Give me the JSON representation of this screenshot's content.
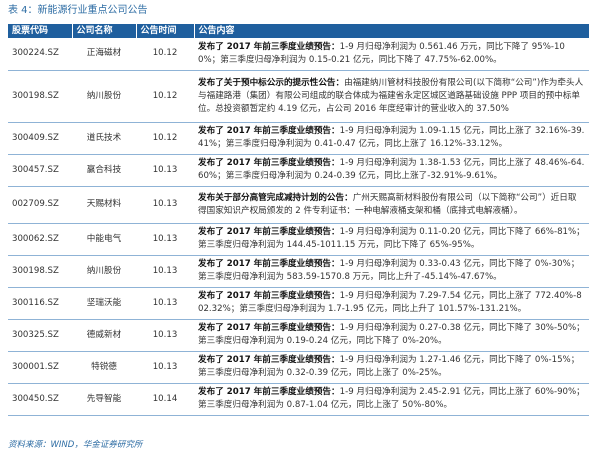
{
  "caption": "表 4：新能源行业重点公司公告",
  "headers": {
    "code": "股票代码",
    "name": "公司名称",
    "time": "公告时间",
    "content": "公告内容"
  },
  "rows": [
    {
      "code": "300224.SZ",
      "name": "正海磁材",
      "date": "10.12",
      "title": "发布了 2017 年前三季度业绩预告：",
      "body": "1-9 月归母净利润为 0.561.46 万元，同比下降了 95%-100%；第三季度归母净利润为 0.15-0.21 亿元，同比下降了 47.75%-62.00%。"
    },
    {
      "code": "300198.SZ",
      "name": "纳川股份",
      "date": "10.12",
      "title": "发布了关于预中标公示的提示性公告：",
      "body": "由福建纳川管材科技股份有限公司(以下简称“公司”)作为牵头人与福建路港（集团）有限公司组成的联合体成为福建省永定区城区道路基础设施 PPP 项目的预中标单位。总投资额暂定约 4.19 亿元，占公司 2016 年度经审计的营业收入的 37.50%"
    },
    {
      "code": "300409.SZ",
      "name": "道氏技术",
      "date": "10.12",
      "title": "发布了 2017 年前三季度业绩预告：",
      "body": "1-9 月归母净利润为 1.09-1.15 亿元，同比上涨了 32.16%-39.41%；第三季度归母净利润为 0.41-0.47 亿元，同比上涨了 16.12%-33.12%。"
    },
    {
      "code": "300457.SZ",
      "name": "赢合科技",
      "date": "10.13",
      "title": "发布了 2017 年前三季度业绩预告：",
      "body": "1-9 月归母净利润为 1.38-1.53 亿元，同比上涨了 48.46%-64.60%；第三季度归母净利润为 0.24-0.39 亿元，同比上涨了-32.91%-9.61%。"
    },
    {
      "code": "002709.SZ",
      "name": "天赐材料",
      "date": "10.13",
      "title": "发布关于部分高管完成减持计划的公告：",
      "body": "广州天赐高新材料股份有限公司（以下简称“公司”）近日取得国家知识产权局颁发的 2 件专利证书：一种电解液桶支架和桶（底排式电解液桶）。"
    },
    {
      "code": "300062.SZ",
      "name": "中能电气",
      "date": "10.13",
      "title": "发布了 2017 年前三季度业绩预告：",
      "body": "1-9 月归母净利润为 0.11-0.20 亿元，同比下降了 66%-81%；第三季度归母净利润为 144.45-1011.15 万元，同比下降了 65%-95%。"
    },
    {
      "code": "300198.SZ",
      "name": "纳川股份",
      "date": "10.13",
      "title": "发布了 2017 年前三季度业绩预告：",
      "body": "1-9 月归母净利润为 0.33-0.43 亿元，同比下降了 0%-30%；第三季度归母净利润为 583.59-1570.8 万元，同比上升了-45.14%-47.67%。"
    },
    {
      "code": "300116.SZ",
      "name": "坚瑞沃能",
      "date": "10.13",
      "title": "发布了 2017 年前三季度业绩预告：",
      "body": "1-9 月归母净利润为 7.29-7.54 亿元，同比上涨了 772.40%-802.32%；第三季度归母净利润为 1.7-1.95 亿元，同比上升了 101.57%-131.21%。"
    },
    {
      "code": "300325.SZ",
      "name": "德威新材",
      "date": "10.13",
      "title": "发布了 2017 年前三季度业绩预告：",
      "body": "1-9 月归母净利润为 0.27-0.38 亿元，同比下降了 30%-50%；第三季度归母净利润为 0.19-0.24 亿元，同比下降了 0%-20%。"
    },
    {
      "code": "300001.SZ",
      "name": "特锐德",
      "date": "10.13",
      "title": "发布了 2017 年前三季度业绩预告：",
      "body": "1-9 月归母净利润为 1.27-1.46 亿元，同比下降了 0%-15%；第三季度归母净利润为 0.32-0.39 亿元，同比上涨了 0%-25%。"
    },
    {
      "code": "300450.SZ",
      "name": "先导智能",
      "date": "10.14",
      "title": "发布了 2017 年前三季度业绩预告：",
      "body": "1-9 月归母净利润为 2.45-2.91 亿元，同比上涨了 60%-90%；第三季度归母净利润为 0.87-1.04 亿元，同比上涨了 50%-80%。"
    }
  ],
  "source": "资料来源：WIND，华金证券研究所"
}
